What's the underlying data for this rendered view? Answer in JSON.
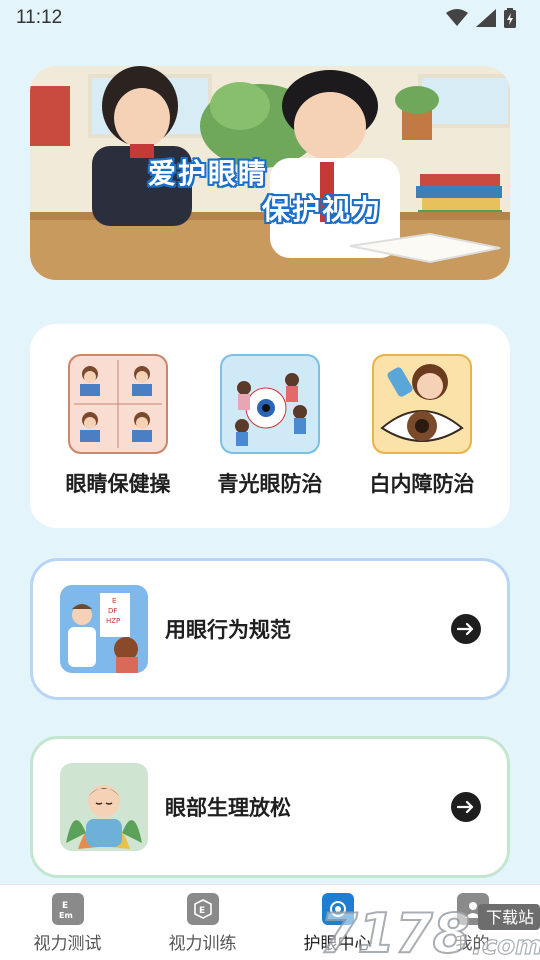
{
  "status_bar": {
    "time": "11:12"
  },
  "banner": {
    "line1": "爱护眼睛",
    "line2": "保护视力"
  },
  "categories": [
    {
      "label": "眼睛保健操",
      "icon": "eye-exercise-illustration"
    },
    {
      "label": "青光眼防治",
      "icon": "glaucoma-illustration"
    },
    {
      "label": "白内障防治",
      "icon": "cataract-illustration"
    }
  ],
  "cards": [
    {
      "title": "用眼行为规范",
      "icon": "eye-chart-doctor-illustration"
    },
    {
      "title": "眼部生理放松",
      "icon": "relaxing-child-illustration"
    }
  ],
  "nav": {
    "items": [
      {
        "label": "视力测试",
        "icon": "vision-test-icon"
      },
      {
        "label": "视力训练",
        "icon": "vision-training-icon"
      },
      {
        "label": "护眼中心",
        "icon": "eye-care-center-icon",
        "active": true
      },
      {
        "label": "我的",
        "icon": "profile-icon"
      }
    ]
  },
  "watermark": {
    "text": "7178.com",
    "badge": "下载站"
  },
  "colors": {
    "background": "#e4f4fb",
    "card_blue_border": "#b9d4f4",
    "card_green_border": "#c4e6cf",
    "banner_text_stroke": "#1b6fc7"
  }
}
